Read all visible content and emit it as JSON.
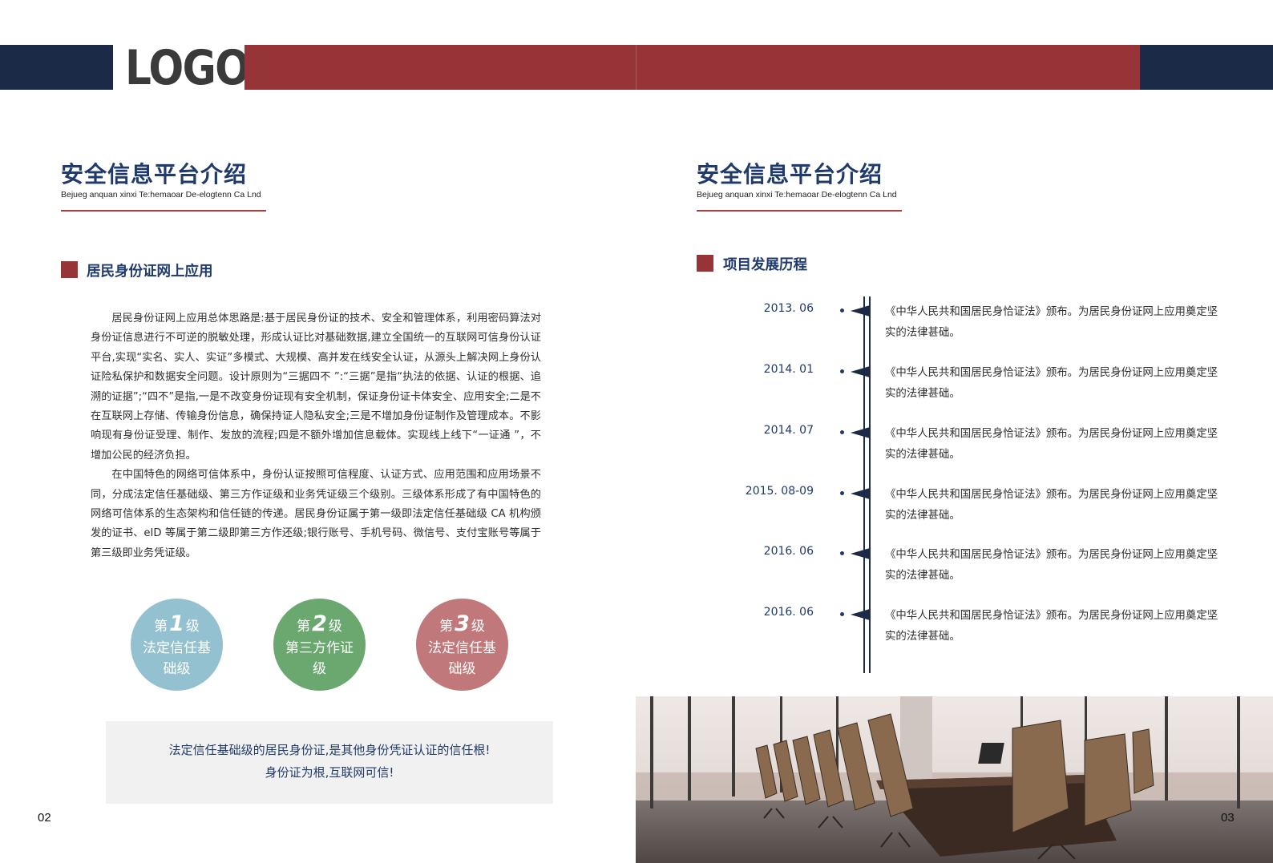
{
  "header": {
    "logo_text": "LOGO"
  },
  "left_page": {
    "section_title": "安全信息平台介绍",
    "section_subtitle": "Bejueg anquan xinxi Te:hemaoar De-elogtenn Ca Lnd",
    "subsection_title": "居民身份证网上应用",
    "paragraphs": [
      "居民身份证网上应用总体思路是:基于居民身份证的技术、安全和管理体系，利用密码算法对身份证信息进行不可逆的脱敏处理，形成认证比对基础数据,建立全国统一的互联网可信身份认证平台,实现“实名、实人、实证”多模式、大规模、高并发在线安全认证，从源头上解决网上身份认证险私保护和数据安全问题。设计原则为“三据四不 ”:“三据”是指“执法的依据、认证的根据、追溯的证据”;“四不”是指,一是不改变身份证现有安全机制，保证身份证卡体安全、应用安全;二是不在互联网上存储、传输身份信息，确保持证人隐私安全;三是不增加身份证制作及管理成本。不影响现有身份证受理、制作、发放的流程;四是不额外增加信息载体。实现线上线下“一证通 ”，不增加公民的经济负担。",
      "在中国特色的网络可信体系中，身份认证按照可信程度、认证方式、应用范围和应用场景不同，分成法定信任基础级、第三方作证级和业务凭证级三个级别。三级体系形成了有中国特色的网络可信体系的生态架构和信任链的传递。居民身份证属于第一级即法定信任基础级 CA 机构颁发的证书、eID 等属于第二级即第三方作还级;银行账号、手机号码、微信号、支付宝账号等属于第三级即业务凭证级。"
    ],
    "levels": [
      {
        "prefix": "第",
        "number": "1",
        "suffix": "级",
        "desc": "法定信任基础级",
        "color": "#94c1cf"
      },
      {
        "prefix": "第",
        "number": "2",
        "suffix": "级",
        "desc": "第三方作证级",
        "color": "#6aa86f"
      },
      {
        "prefix": "第",
        "number": "3",
        "suffix": "级",
        "desc": "法定信任基础级",
        "color": "#c1787a"
      }
    ],
    "callout_line1": "法定信任基础级的居民身份证,是其他身份凭证认证的信任根!",
    "callout_line2": "身份证为根,互联网可信!",
    "page_number": "02"
  },
  "right_page": {
    "section_title": "安全信息平台介绍",
    "section_subtitle": "Bejueg anquan xinxi Te:hemaoar De-elogtenn Ca Lnd",
    "subsection_title": "项目发展历程",
    "timeline": [
      {
        "date": "2013. 06",
        "text": "《中华人民共和国居民身恰证法》颁布。为居民身份证网上应用奠定坚实的法律甚础。"
      },
      {
        "date": "2014. 01",
        "text": "《中华人民共和国居民身恰证法》颁布。为居民身份证网上应用奠定坚实的法律甚础。"
      },
      {
        "date": "2014. 07",
        "text": "《中华人民共和国居民身恰证法》颁布。为居民身份证网上应用奠定坚实的法律甚础。"
      },
      {
        "date": "2015. 08-09",
        "text": "《中华人民共和国居民身恰证法》颁布。为居民身份证网上应用奠定坚实的法律甚础。"
      },
      {
        "date": "2016. 06",
        "text": "《中华人民共和国居民身恰证法》颁布。为居民身份证网上应用奠定坚实的法律甚础。"
      },
      {
        "date": "2016. 06",
        "text": "《中华人民共和国居民身恰证法》颁布。为居民身份证网上应用奠定坚实的法律甚础。"
      }
    ],
    "page_number": "03"
  },
  "colors": {
    "navy": "#1b2a47",
    "brand_red": "#973437",
    "title_blue": "#1f3a6b"
  }
}
